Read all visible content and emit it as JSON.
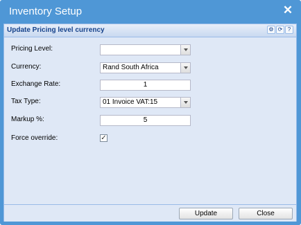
{
  "window": {
    "title": "Inventory Setup",
    "close_glyph": "✕"
  },
  "panel": {
    "title": "Update Pricing level currency",
    "tools": [
      "gear-icon",
      "refresh-icon",
      "help-icon"
    ]
  },
  "form": {
    "pricing_level": {
      "label": "Pricing Level:",
      "value": ""
    },
    "currency": {
      "label": "Currency:",
      "value": "Rand South Africa"
    },
    "exchange_rate": {
      "label": "Exchange Rate:",
      "value": "1"
    },
    "tax_type": {
      "label": "Tax Type:",
      "value": "01 Invoice VAT:15"
    },
    "markup": {
      "label": "Markup %:",
      "value": "5"
    },
    "force_override": {
      "label": "Force override:",
      "checked": true,
      "glyph": "✓"
    }
  },
  "footer": {
    "update_label": "Update",
    "close_label": "Close"
  },
  "colors": {
    "window_blue": "#4f97d6",
    "panel_bg": "#dfe8f6",
    "header_text": "#15428b"
  }
}
